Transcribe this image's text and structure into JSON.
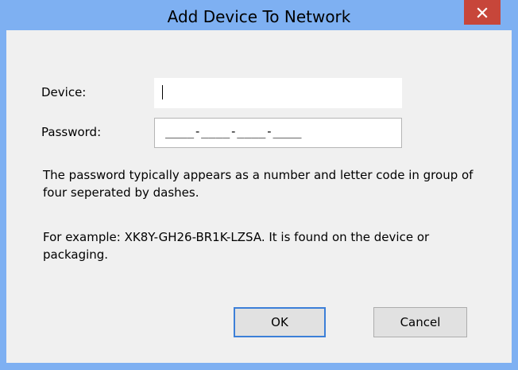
{
  "window": {
    "title": "Add Device To Network"
  },
  "form": {
    "device_label": "Device:",
    "device_value": "",
    "password_label": "Password:",
    "password_mask": "____-____-____-____"
  },
  "help": {
    "line1": "The password typically appears as a number and letter code in group of four seperated by dashes.",
    "line2": "For example: XK8Y-GH26-BR1K-LZSA. It is found on the device or packaging."
  },
  "buttons": {
    "ok_label": "OK",
    "cancel_label": "Cancel"
  },
  "icons": {
    "close": "close-icon"
  },
  "colors": {
    "title_bar": "#7eb0f2",
    "close_button": "#c7463a",
    "dialog_body": "#f0f0f0",
    "default_button_border": "#3c7fd8"
  }
}
